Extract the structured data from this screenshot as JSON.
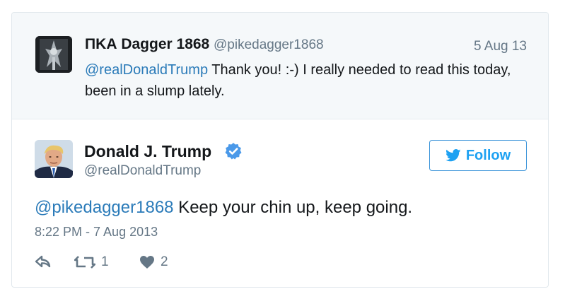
{
  "parent_tweet": {
    "display_name": "ΠΚΑ Dagger 1868",
    "handle": "@pikedagger1868",
    "date": "5 Aug 13",
    "mention": "@realDonaldTrump",
    "text": " Thank you! :-) I really needed to read this today, been in a slump lately."
  },
  "main_tweet": {
    "display_name": "Donald J. Trump",
    "handle": "@realDonaldTrump",
    "follow_label": "Follow",
    "mention": "@pikedagger1868",
    "text": " Keep your chin up, keep going.",
    "timestamp": "8:22 PM - 7 Aug 2013",
    "actions": {
      "reply_icon": "reply-icon",
      "retweet_icon": "retweet-icon",
      "retweet_count": "1",
      "like_icon": "heart-icon",
      "like_count": "2"
    }
  },
  "colors": {
    "link": "#2b7bb9",
    "brand": "#1da1f2",
    "muted": "#657786",
    "parent_bg": "#f5f8fa"
  }
}
